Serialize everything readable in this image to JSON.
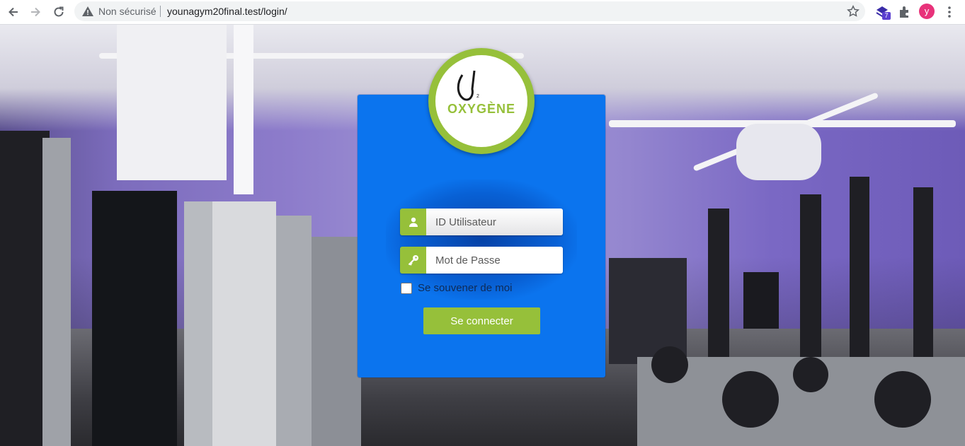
{
  "browser": {
    "security_label": "Non sécurisé",
    "url": "younagym20final.test/login/",
    "extension_badge": "7",
    "profile_initial": "y"
  },
  "login": {
    "logo_text": "OXYGÈNE",
    "username_placeholder": "ID Utilisateur",
    "password_placeholder": "Mot de Passe",
    "remember_label": "Se souvener de moi",
    "submit_label": "Se connecter"
  },
  "colors": {
    "card_blue": "#0b74ee",
    "accent_green": "#96c03a"
  }
}
